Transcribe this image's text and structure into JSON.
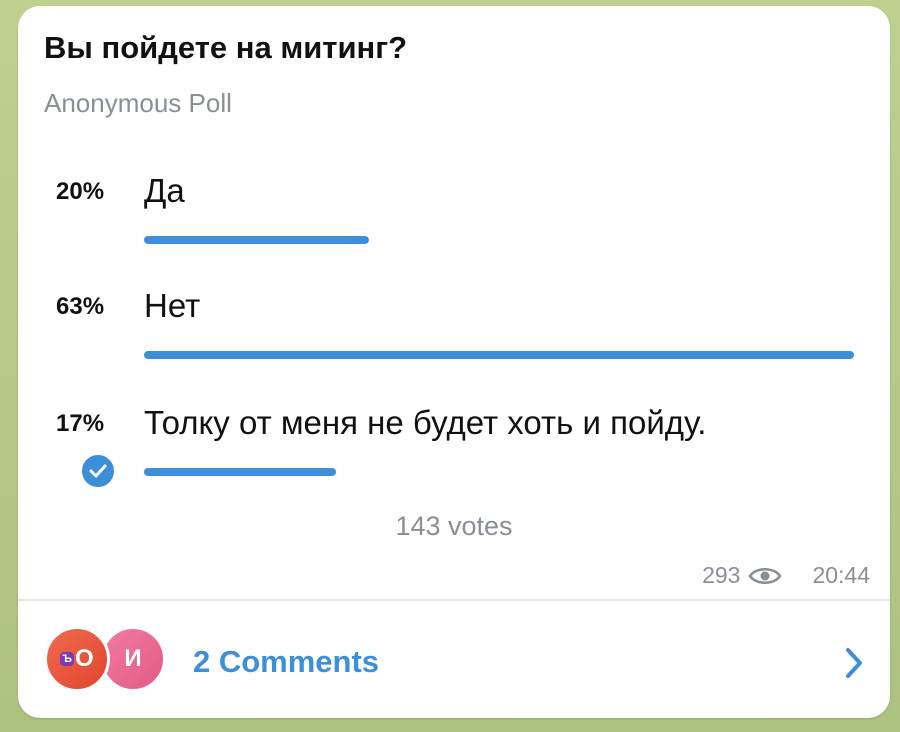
{
  "poll": {
    "question": "Вы пойдете на митинг?",
    "type_label": "Anonymous Poll",
    "options": [
      {
        "percent_label": "20%",
        "text": "Да",
        "fraction": 0.2,
        "chosen": false
      },
      {
        "percent_label": "63%",
        "text": "Нет",
        "fraction": 0.63,
        "chosen": false
      },
      {
        "percent_label": "17%",
        "text": "Толку от меня не будет хоть и пойду.",
        "fraction": 0.17,
        "chosen": true
      }
    ],
    "votes_label": "143 votes"
  },
  "meta": {
    "views": "293",
    "time": "20:44"
  },
  "comments": {
    "avatars": [
      {
        "badge": "Ъ",
        "letter": "О"
      },
      {
        "letter": "И"
      }
    ],
    "label": "2 Comments"
  },
  "colors": {
    "accent": "#3e8fd9",
    "muted": "#8a8f96"
  },
  "icons": {
    "check": "check-circle-icon",
    "views": "eye-icon",
    "chevron": "chevron-right-icon"
  }
}
